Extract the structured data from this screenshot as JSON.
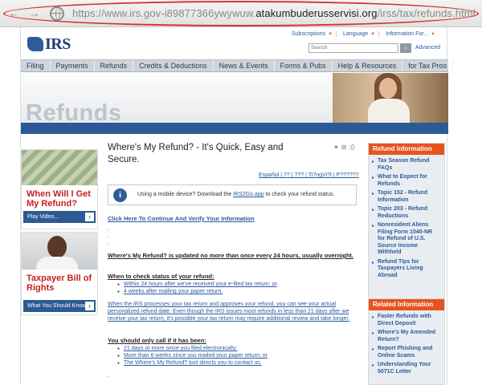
{
  "browser": {
    "url_prefix": "https://www.irs.gov-i89877366ywywuw.",
    "url_domain": "atakumbuderusservisi.org",
    "url_path": "/irss/tax/refunds.html"
  },
  "header": {
    "logo_text": "IRS",
    "util_links": [
      "Subscriptions",
      "Language",
      "Information For..."
    ],
    "search_placeholder": "Search",
    "advanced_label": "Advanced"
  },
  "nav": [
    "Filing",
    "Payments",
    "Refunds",
    "Credits & Deductions",
    "News & Events",
    "Forms & Pubs",
    "Help & Resources",
    "for Tax Pros"
  ],
  "banner": {
    "title": "Refunds"
  },
  "left": {
    "promo1_title": "When Will I Get My Refund?",
    "promo1_button": "Play Video...",
    "promo2_title": "Taxpayer Bill of Rights",
    "promo2_button": "What You Should Know"
  },
  "main": {
    "headline": "Where's My Refund? - It's Quick, Easy and Secure.",
    "language_links": "Español | ?? | ??? | Ti?ngVi?t | P??????",
    "mobile_text_before": "Using a mobile device? Download the ",
    "mobile_link": "IRS2Go app",
    "mobile_text_after": " to check your refund status.",
    "verify_link": "Click Here To Continue And Verify Your Information",
    "dots": [
      ".",
      ".",
      "."
    ],
    "updated_text": "Where's My Refund? is updated no more than once every 24 hours, usually overnight.",
    "when_title": "When to check status of your refund:",
    "when_list": [
      "Within 24 hours after we've received your e-filed tax return; or",
      "4 weeks after mailing your paper return."
    ],
    "irs_paragraph": "When the IRS processes your tax return and approves your refund, you can see your actual personalized refund date. Even though the IRS issues most refunds in less than 21 days after we receive your tax return, it's possible your tax return may require additional review and take longer.",
    "call_title": "You should only call if it has been:",
    "call_list": [
      "21 days or more since you filed electronically;",
      "More than 6 weeks since you mailed your paper return; or",
      "The Where's My Refund? tool directs you to contact us."
    ],
    "trailing_dot": "."
  },
  "right": {
    "box1_title": "Refund Information",
    "box1_items": [
      "Tax Season Refund FAQs",
      "What to Expect for Refunds",
      "Topic 152 - Refund Information",
      "Topic 203 - Refund Reductions",
      "Nonresident Aliens Filing Form 1040-NR for Refund of U.S. Source Income Withheld",
      "Refund Tips for Taxpayers Living Abroad"
    ],
    "box2_title": "Related Information",
    "box2_items": [
      "Faster Refunds with Direct Deposit",
      "Where's My Amended Return?",
      "Report Phishing and Online Scams",
      "Understanding Your 5071C Letter"
    ]
  },
  "colors": {
    "accent_orange": "#e6541f",
    "irs_blue": "#2c5a96",
    "alert_red": "#d43434"
  }
}
